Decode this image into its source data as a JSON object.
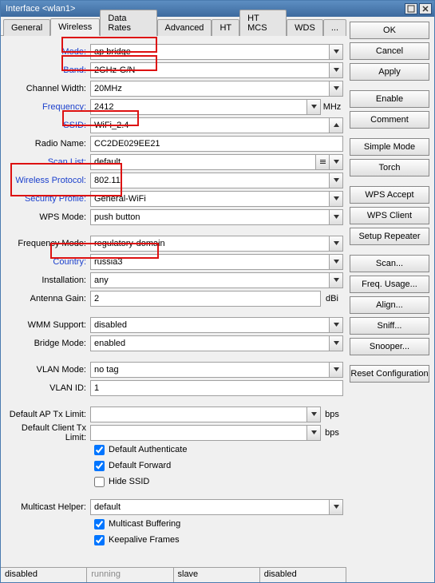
{
  "title": "Interface <wlan1>",
  "tabs": [
    "General",
    "Wireless",
    "Data Rates",
    "Advanced",
    "HT",
    "HT MCS",
    "WDS",
    "..."
  ],
  "activeTab": "Wireless",
  "labels": {
    "mode": "Mode:",
    "band": "Band:",
    "chwidth": "Channel Width:",
    "freq": "Frequency:",
    "ssid": "SSID:",
    "radname": "Radio Name:",
    "scanlist": "Scan List:",
    "wproto": "Wireless Protocol:",
    "secprof": "Security Profile:",
    "wpsmode": "WPS Mode:",
    "freqmode": "Frequency Mode:",
    "country": "Country:",
    "install": "Installation:",
    "antgain": "Antenna Gain:",
    "wmm": "WMM Support:",
    "bridgemode": "Bridge Mode:",
    "vlanmode": "VLAN Mode:",
    "vlanid": "VLAN ID:",
    "defaptx": "Default AP Tx Limit:",
    "defcltx": "Default Client Tx Limit:",
    "mhelper": "Multicast Helper:"
  },
  "values": {
    "mode": "ap bridge",
    "band": "2GHz-G/N",
    "chwidth": "20MHz",
    "freq": "2412",
    "ssid": "WiFi_2.4",
    "radname": "CC2DE029EE21",
    "scanlist": "default",
    "wproto": "802.11",
    "secprof": "General-WiFi",
    "wpsmode": "push button",
    "freqmode": "regulatory-domain",
    "country": "russia3",
    "install": "any",
    "antgain": "2",
    "wmm": "disabled",
    "bridgemode": "enabled",
    "vlanmode": "no tag",
    "vlanid": "1",
    "defaptx": "",
    "defcltx": "",
    "mhelper": "default"
  },
  "units": {
    "freq": "MHz",
    "antgain": "dBi",
    "bps": "bps"
  },
  "checks": {
    "defauth": "Default Authenticate",
    "deffwd": "Default Forward",
    "hidessid": "Hide SSID",
    "mbuf": "Multicast Buffering",
    "keepalive": "Keepalive Frames"
  },
  "buttons": [
    "OK",
    "Cancel",
    "Apply",
    "Enable",
    "Comment",
    "Simple Mode",
    "Torch",
    "WPS Accept",
    "WPS Client",
    "Setup Repeater",
    "Scan...",
    "Freq. Usage...",
    "Align...",
    "Sniff...",
    "Snooper...",
    "Reset Configuration"
  ],
  "status": [
    "disabled",
    "running",
    "slave",
    "disabled"
  ]
}
